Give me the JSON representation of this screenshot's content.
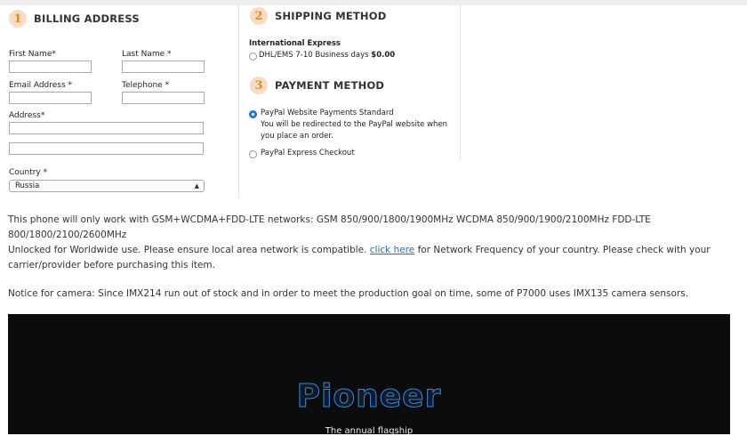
{
  "billing": {
    "step": "1",
    "title": "BILLING ADDRESS",
    "first_name_label": "First Name*",
    "last_name_label": "Last Name *",
    "email_label": "Email Address *",
    "telephone_label": "Telephone *",
    "address_label": "Address*",
    "country_label": "Country *",
    "country_value": "Russia",
    "first_name_value": "",
    "last_name_value": "",
    "email_value": "",
    "telephone_value": "",
    "address1_value": "",
    "address2_value": ""
  },
  "shipping": {
    "step": "2",
    "title": "SHIPPING METHOD",
    "group": "International Express",
    "option_label": "DHL/EMS 7-10 Business days",
    "option_price": "$0.00"
  },
  "payment": {
    "step": "3",
    "title": "PAYMENT METHOD",
    "option1": "PayPal Website Payments Standard",
    "option1_desc_line1": "You will be redirected to the PayPal website when",
    "option1_desc_line2": "you place an order.",
    "option2": "PayPal Express Checkout"
  },
  "description": {
    "networks": "This phone will only work with GSM+WCDMA+FDD-LTE networks: GSM 850/900/1800/1900MHz WCDMA 850/900/1900/2100MHz FDD-LTE 800/1800/2100/2600MHz",
    "unlocked_before": "Unlocked for Worldwide use. Please ensure local area network is compatible.",
    "link": "click here",
    "unlocked_after": "for Network Frequency of your country. Please check with your carrier/provider before purchasing this item.",
    "camera_notice": "Notice for camera: Since IMX214 run out of stock and in order to meet the production goal on time, some of P7000 uses IMX135 camera sensors."
  },
  "banner": {
    "brand": "Pioneer",
    "tagline": "The annual flagship"
  },
  "colors": {
    "step_badge_bg": "#f6dcc3",
    "step_badge_text": "#e08a2a",
    "link": "#2e6da4",
    "radio_selected": "#2a7fd4",
    "banner_bg": "#0b0c0e",
    "brand_glow": "#3f89d6"
  }
}
